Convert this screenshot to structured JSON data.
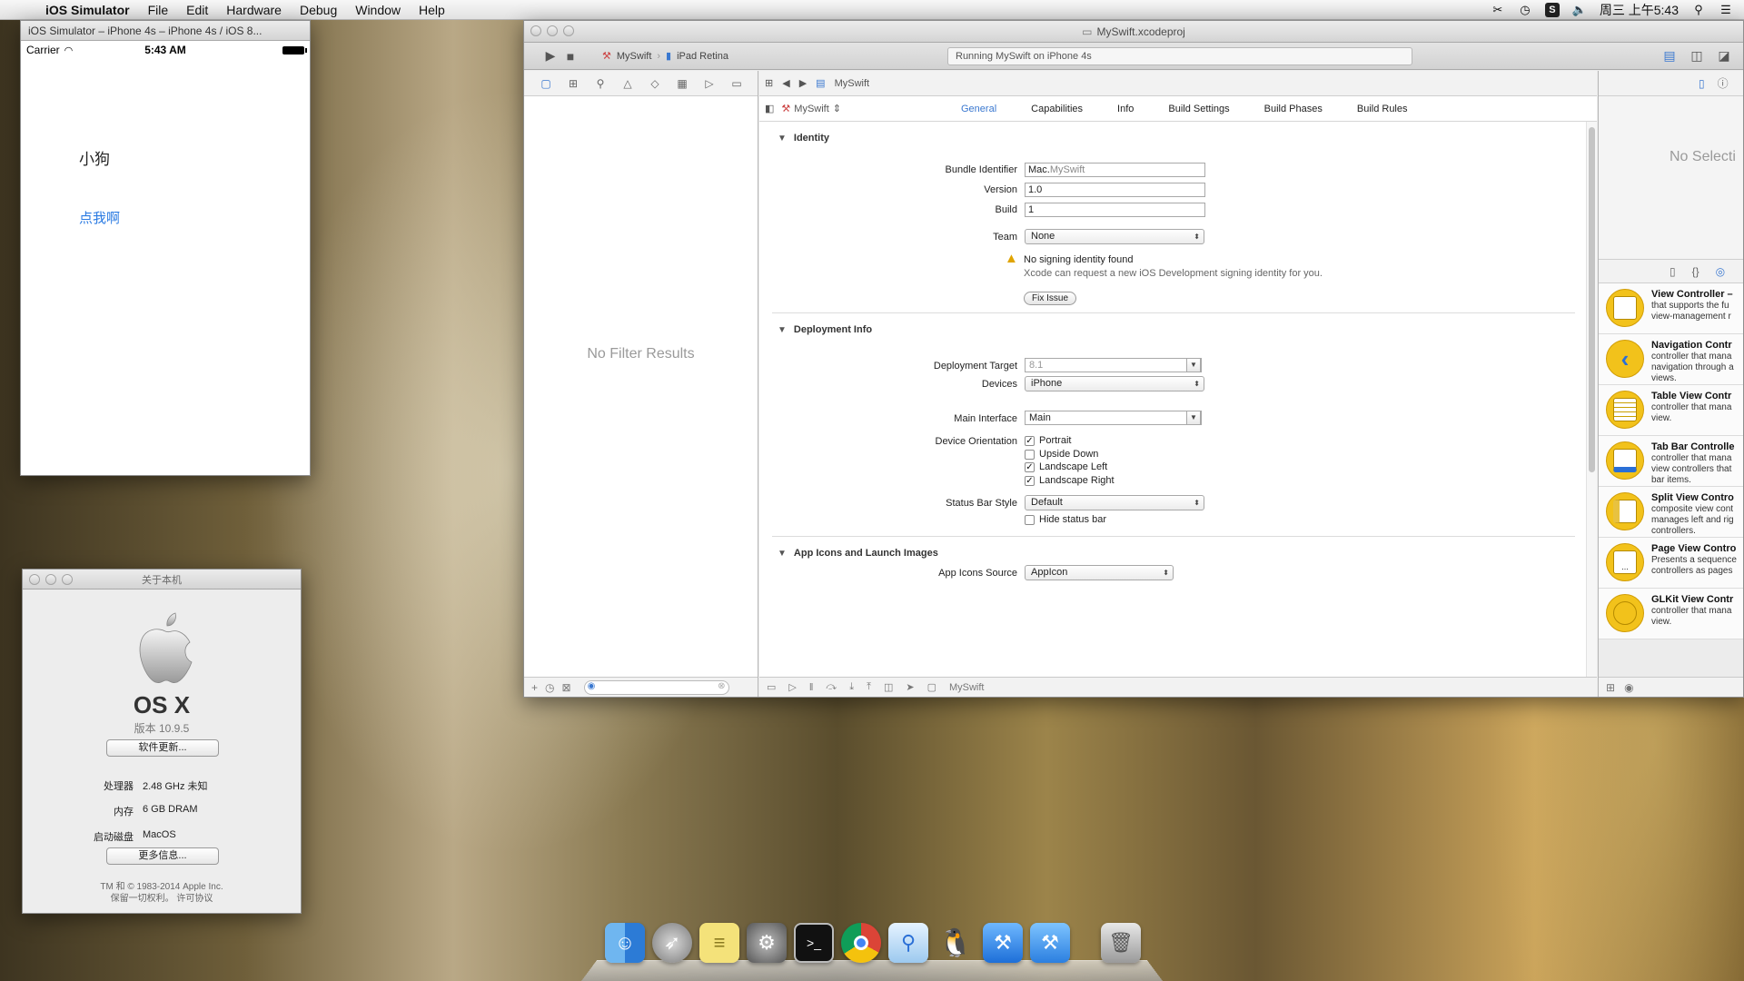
{
  "menubar": {
    "app_name": "iOS Simulator",
    "items": [
      "File",
      "Edit",
      "Hardware",
      "Debug",
      "Window",
      "Help"
    ],
    "clock": "周三 上午5:43"
  },
  "simulator": {
    "title": "iOS Simulator – iPhone 4s – iPhone 4s / iOS 8...",
    "carrier": "Carrier",
    "time": "5:43 AM",
    "label": "小狗",
    "button": "点我啊"
  },
  "about": {
    "title": "关于本机",
    "os_name": "OS X",
    "version": "版本 10.9.5",
    "update_button": "软件更新...",
    "rows": [
      {
        "k": "处理器",
        "v": "2.48 GHz 未知"
      },
      {
        "k": "内存",
        "v": "6 GB DRAM"
      },
      {
        "k": "启动磁盘",
        "v": "MacOS"
      }
    ],
    "more_button": "更多信息...",
    "copyright": "TM 和 © 1983-2014 Apple Inc.",
    "rights": "保留一切权利。 许可协议"
  },
  "xcode": {
    "title": "MySwift.xcodeproj",
    "scheme": "MySwift",
    "device": "iPad Retina",
    "activity": "Running MySwift on iPhone 4s",
    "jump_crumb": "MySwift",
    "target": "MySwift",
    "tabs": [
      "General",
      "Capabilities",
      "Info",
      "Build Settings",
      "Build Phases",
      "Build Rules"
    ],
    "active_tab": "General",
    "no_filter": "No Filter Results",
    "identity": {
      "header": "Identity",
      "bundle_label": "Bundle Identifier",
      "bundle_prefix": "Mac.",
      "bundle_value": "MySwift",
      "version_label": "Version",
      "version_value": "1.0",
      "build_label": "Build",
      "build_value": "1",
      "team_label": "Team",
      "team_value": "None",
      "warn_title": "No signing identity found",
      "warn_text": "Xcode can request a new iOS Development signing identity for you.",
      "fix_button": "Fix Issue"
    },
    "deployment": {
      "header": "Deployment Info",
      "target_label": "Deployment Target",
      "target_value": "8.1",
      "devices_label": "Devices",
      "devices_value": "iPhone",
      "interface_label": "Main Interface",
      "interface_value": "Main",
      "orientation_label": "Device Orientation",
      "orientations": [
        {
          "label": "Portrait",
          "checked": true
        },
        {
          "label": "Upside Down",
          "checked": false
        },
        {
          "label": "Landscape Left",
          "checked": true
        },
        {
          "label": "Landscape Right",
          "checked": true
        }
      ],
      "statusbar_label": "Status Bar Style",
      "statusbar_value": "Default",
      "hide_status": "Hide status bar"
    },
    "icons_section": {
      "header": "App Icons and Launch Images",
      "source_label": "App Icons Source",
      "source_value": "AppIcon"
    },
    "debug_target": "MySwift",
    "inspector_empty": "No Selecti",
    "library": [
      {
        "title": "View Controller –",
        "l1": "that supports the fu",
        "l2": "view-management r"
      },
      {
        "title": "Navigation Contr",
        "l1": "controller that mana",
        "l2": "navigation through a",
        "l3": "views."
      },
      {
        "title": "Table View Contr",
        "l1": "controller that mana",
        "l2": "view."
      },
      {
        "title": "Tab Bar Controlle",
        "l1": "controller that mana",
        "l2": "view controllers that",
        "l3": "bar items."
      },
      {
        "title": "Split View Contro",
        "l1": "composite view cont",
        "l2": "manages left and rig",
        "l3": "controllers."
      },
      {
        "title": "Page View Contro",
        "l1": "Presents a sequence",
        "l2": "controllers as pages"
      },
      {
        "title": "GLKit View Contr",
        "l1": "controller that mana",
        "l2": "view."
      }
    ]
  },
  "colors": {
    "accent": "#3a78d0",
    "link": "#2a7ae2",
    "library_icon": "#f2c21b",
    "warning": "#e0a400"
  },
  "dock": {
    "apps": [
      "finder-icon",
      "launchpad-icon",
      "stickies-icon",
      "system-preferences-icon",
      "terminal-icon",
      "chrome-icon",
      "preview-icon",
      "qq-icon",
      "xcode-icon",
      "xcode-beta-icon",
      "trash-icon"
    ]
  }
}
